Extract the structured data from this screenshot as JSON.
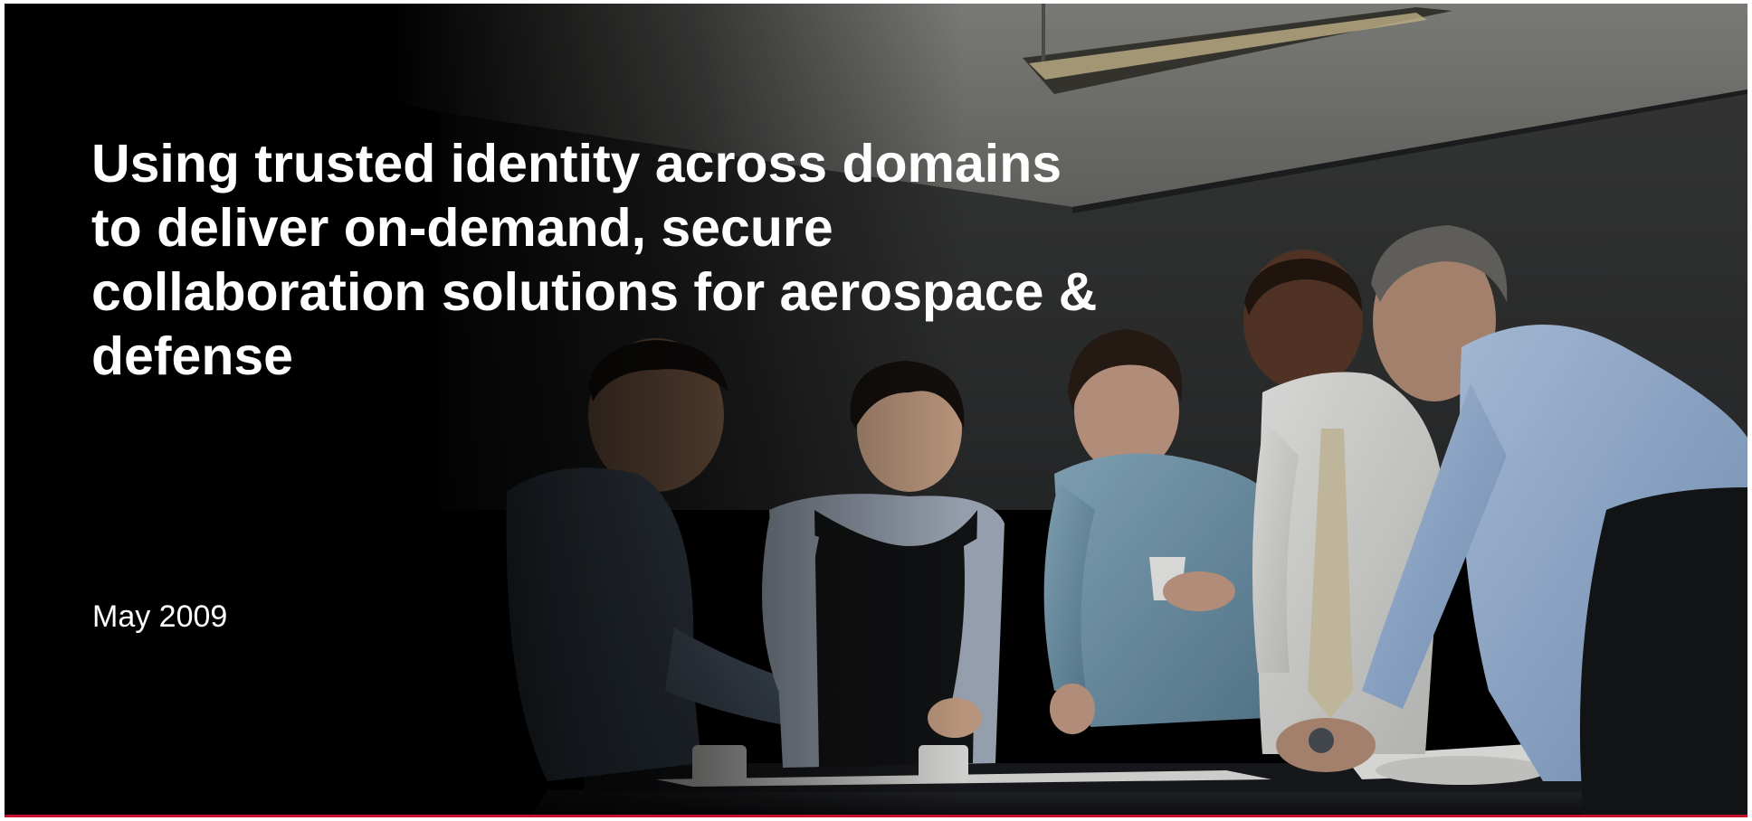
{
  "slide": {
    "title": "Using trusted identity across domains\nto deliver on-demand, secure\ncollaboration solutions for aerospace &\ndefense",
    "date": "May 2009"
  },
  "image": {
    "description_icon": "photo-team-meeting-icon"
  },
  "colors": {
    "background": "#000000",
    "text": "#ffffff",
    "accent_rule": "#c8102e"
  }
}
